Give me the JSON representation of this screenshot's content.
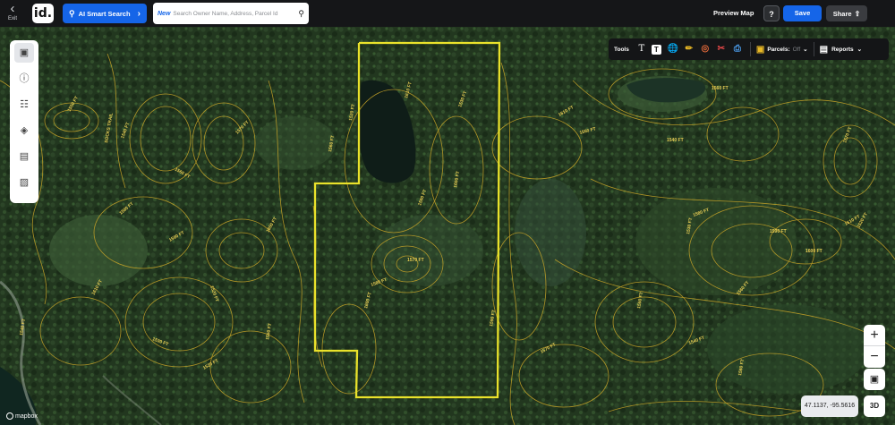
{
  "header": {
    "exit_label": "Exit",
    "logo_text": "id.",
    "ai_search_label": "AI Smart Search",
    "search_badge": "New",
    "search_placeholder": "Search Owner Name, Address, Parcel Id",
    "preview_label": "Preview Map",
    "help_label": "?",
    "save_label": "Save",
    "share_label": "Share"
  },
  "left_toolbar": {
    "items": [
      {
        "icon": "panel-icon",
        "active": true
      },
      {
        "icon": "info-icon"
      },
      {
        "icon": "map-icon"
      },
      {
        "icon": "layers-icon"
      },
      {
        "icon": "buildings-icon"
      },
      {
        "icon": "image-icon"
      }
    ]
  },
  "tools": {
    "label": "Tools",
    "icons": [
      "text-icon",
      "textbox-icon",
      "globe-icon",
      "ruler-icon",
      "target-icon",
      "scissors-icon",
      "print-icon"
    ],
    "parcels_label": "Parcels:",
    "parcels_state": "Off",
    "reports_label": "Reports"
  },
  "map": {
    "coordinates": "47.1137, -95.5616",
    "three_d_label": "3D",
    "attribution": "mapbox",
    "contour_labels": [
      "1550 FT",
      "1540 FT",
      "1560 FT",
      "1570 FT",
      "1580 FT",
      "1590 FT",
      "1600 FT",
      "1610 FT",
      "1520 FT",
      "1530 FT"
    ],
    "trail_label": "SOCKS TRAIL",
    "colors": {
      "boundary": "#e9e22b",
      "contour": "#c9a528"
    }
  }
}
